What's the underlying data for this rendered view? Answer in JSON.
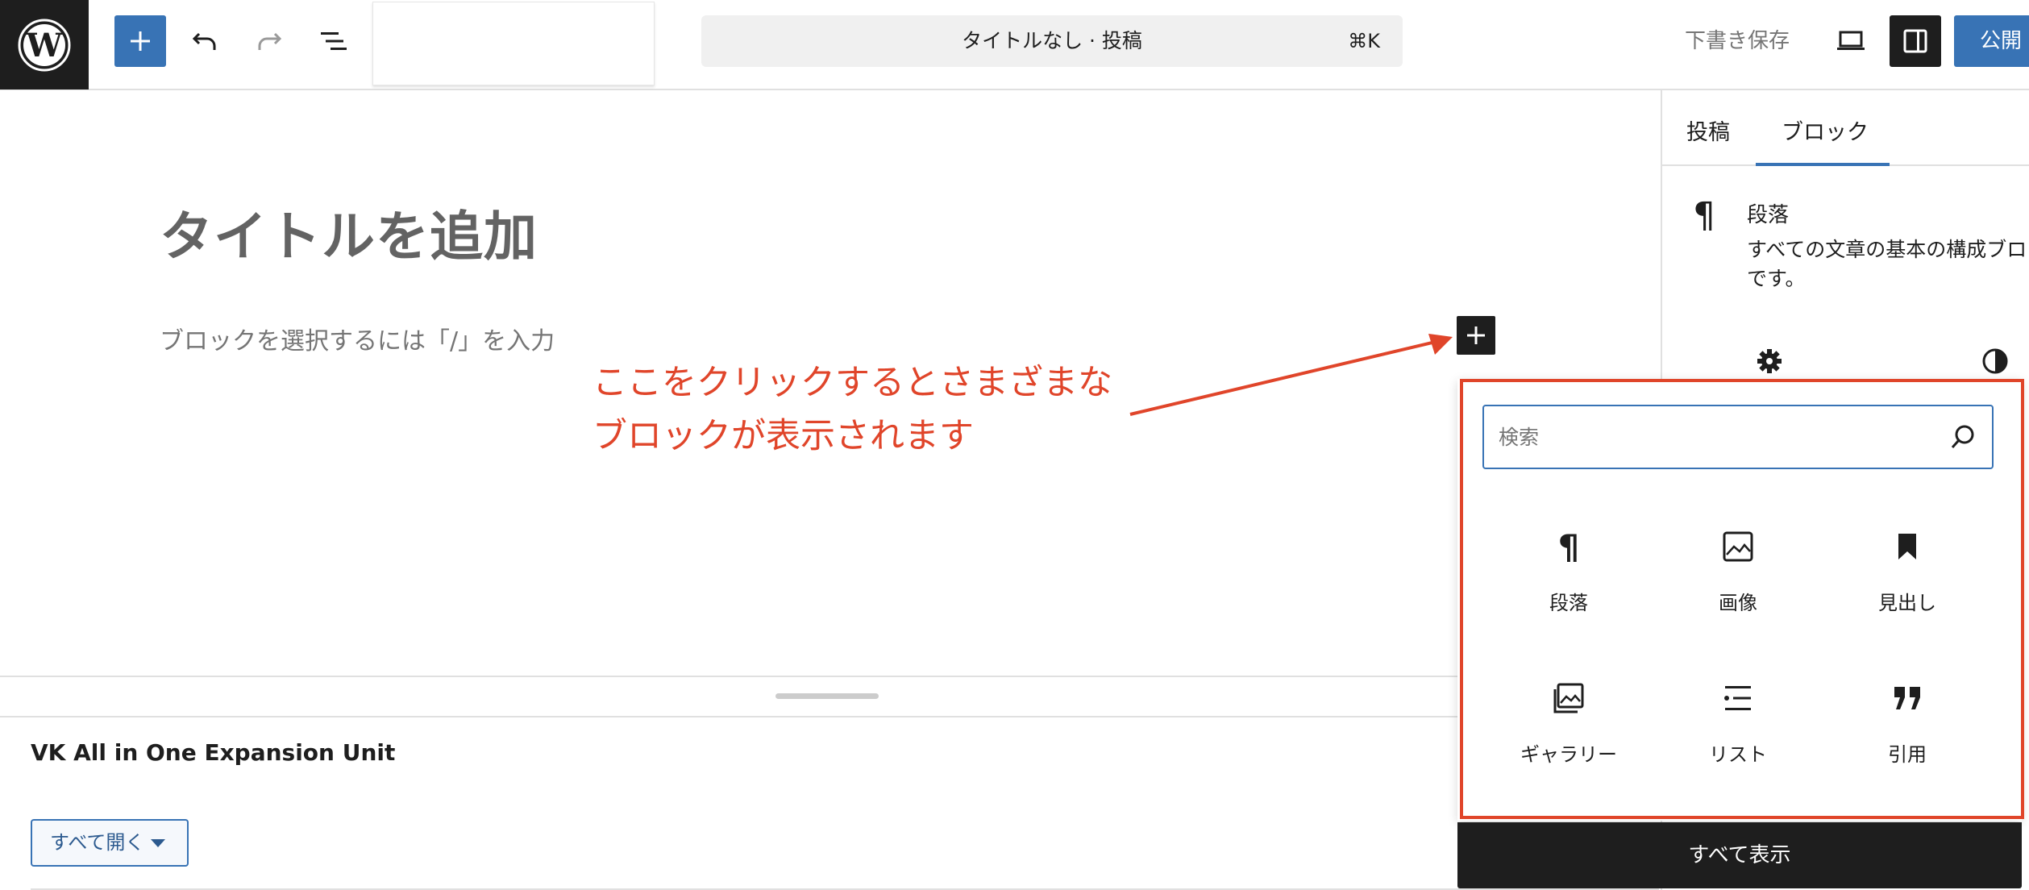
{
  "toolbar": {
    "document_title": "タイトルなし · 投稿",
    "shortcut": "⌘K",
    "save_draft": "下書き保存",
    "publish": "公開",
    "icons": [
      "wordpress-logo",
      "plus-icon",
      "undo-icon",
      "redo-icon",
      "list-view-icon",
      "desktop-preview-icon",
      "sidebar-settings-icon"
    ]
  },
  "editor": {
    "title_placeholder": "タイトルを追加",
    "block_placeholder": "ブロックを選択するには「/」を入力",
    "annotation_line1": "ここをクリックするとさまざまな",
    "annotation_line2": "ブロックが表示されます"
  },
  "metabox": {
    "title": "VK All in One Expansion Unit",
    "expand_all": "すべて開く"
  },
  "sidebar": {
    "tabs": [
      {
        "label": "投稿",
        "active": false
      },
      {
        "label": "ブロック",
        "active": true
      }
    ],
    "block_card": {
      "icon": "paragraph-icon",
      "name": "段落",
      "description": "すべての文章の基本の構成ブロ",
      "description2": "です。"
    }
  },
  "inserter": {
    "search_placeholder": "検索",
    "blocks": [
      {
        "label": "段落",
        "icon": "paragraph-icon"
      },
      {
        "label": "画像",
        "icon": "image-icon"
      },
      {
        "label": "見出し",
        "icon": "heading-bookmark-icon"
      },
      {
        "label": "ギャラリー",
        "icon": "gallery-icon"
      },
      {
        "label": "リスト",
        "icon": "list-icon"
      },
      {
        "label": "引用",
        "icon": "quote-icon"
      }
    ],
    "show_all": "すべて表示"
  },
  "colors": {
    "accent": "#3873b5",
    "annotation": "#e0452a",
    "dark": "#1e1e1e"
  }
}
